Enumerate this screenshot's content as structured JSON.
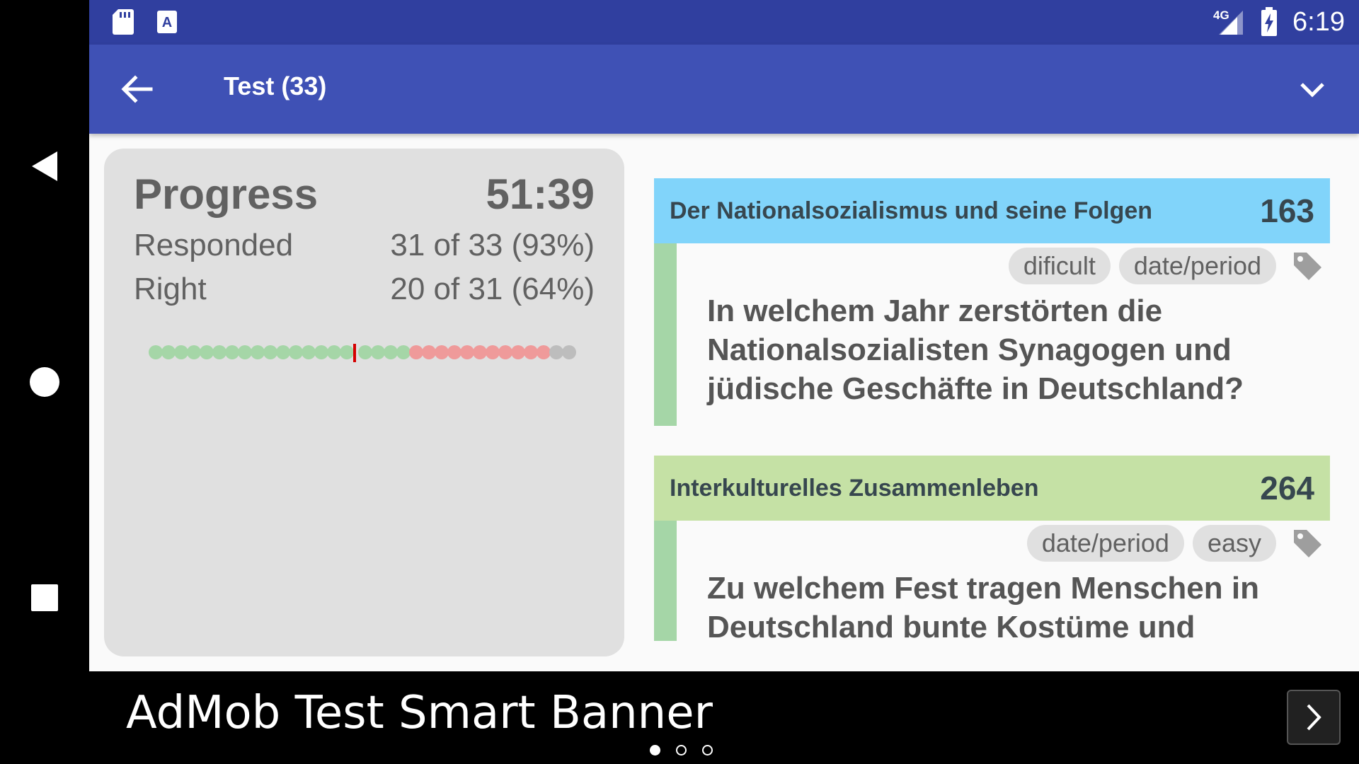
{
  "status_bar": {
    "network": "4G",
    "time": "6:19"
  },
  "app_bar": {
    "title": "Test (33)"
  },
  "progress": {
    "title": "Progress",
    "timer": "51:39",
    "responded_label": "Responded",
    "responded_value": "31 of 33 (93%)",
    "right_label": "Right",
    "right_value": "20 of 31 (64%)",
    "dots_right": 20,
    "dots_wrong": 11,
    "dots_unanswered": 2,
    "current_marker_index": 16,
    "colors": {
      "right": "#a5d6a7",
      "wrong": "#ef9a9a",
      "unanswered": "#bdbdbd",
      "marker": "#d50000"
    }
  },
  "questions": [
    {
      "category": "Der Nationalsozialismus und seine Folgen",
      "number": "163",
      "header_color": "#81d4fa",
      "tags": [
        "dificult",
        "date/period"
      ],
      "text": "In welchem Jahr zerstörten die Nationalsozialisten Synagogen und jüdische Geschäfte in Deutschland?"
    },
    {
      "category": "Interkulturelles Zusammenleben",
      "number": "264",
      "header_color": "#c5e1a5",
      "tags": [
        "date/period",
        "easy"
      ],
      "text": "Zu welchem Fest tragen Menschen in Deutschland bunte Kostüme und"
    }
  ],
  "banner": {
    "text": "AdMob Test Smart Banner"
  },
  "theme": {
    "status_bar": "#303f9f",
    "app_bar": "#3f51b5",
    "background": "#fafafa"
  }
}
